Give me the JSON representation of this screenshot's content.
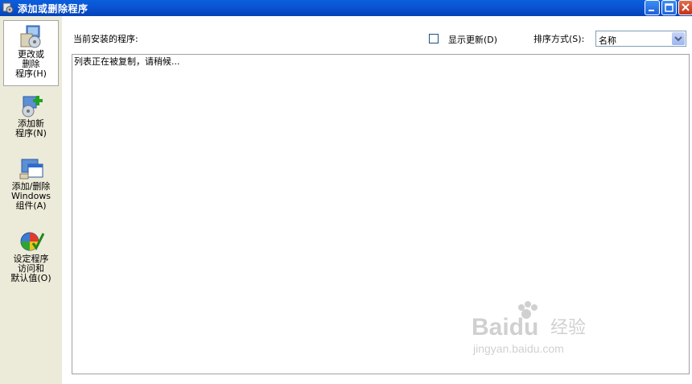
{
  "window": {
    "title": "添加或删除程序"
  },
  "sidebar": {
    "items": [
      {
        "label": "更改或\n删除\n程序(H)",
        "icon": "change-remove-programs-icon",
        "active": true
      },
      {
        "label": "添加新\n程序(N)",
        "icon": "add-new-programs-icon",
        "active": false
      },
      {
        "label": "添加/删除\nWindows\n组件(A)",
        "icon": "windows-components-icon",
        "active": false
      },
      {
        "label": "设定程序\n访问和\n默认值(O)",
        "icon": "program-access-defaults-icon",
        "active": false
      }
    ]
  },
  "main": {
    "current_label": "当前安装的程序:",
    "show_updates_label": "显示更新(D)",
    "show_updates_checked": false,
    "sort_label": "排序方式(S):",
    "sort_value": "名称",
    "list_status": "列表正在被复制，请稍候..."
  },
  "watermark": {
    "brand": "Baidu",
    "suffix": "经验",
    "url": "jingyan.baidu.com"
  },
  "colors": {
    "titlebar": "#0b53d3",
    "sidebar": "#ecead8",
    "close": "#c43216"
  }
}
